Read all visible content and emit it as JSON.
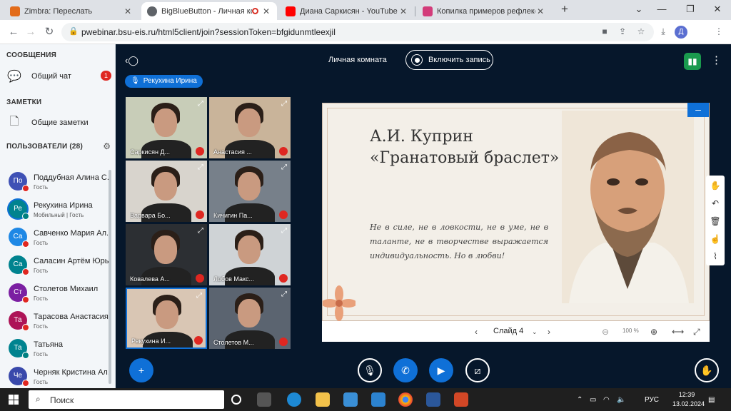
{
  "browser": {
    "tabs": [
      {
        "title": "Zimbra: Переслать",
        "color": "#e26b1a"
      },
      {
        "title": "BigBlueButton - Личная ко",
        "color": "#5f6368"
      },
      {
        "title": "Диана Саркисян - YouTube",
        "color": "#ff0000"
      },
      {
        "title": "Копилка примеров рефлексии",
        "color": "#d33c7a"
      }
    ],
    "new_tab": "+",
    "url": "pwebinar.bsu-eis.ru/html5client/join?sessionToken=bfgidunmtleexjil",
    "profile_initial": "Д"
  },
  "sidebar": {
    "messages_header": "СООБЩЕНИЯ",
    "public_chat": "Общий чат",
    "chat_badge": "1",
    "notes_header": "ЗАМЕТКИ",
    "shared_notes": "Общие заметки",
    "users_header": "ПОЛЬЗОВАТЕЛИ (28)",
    "users": [
      {
        "initials": "По",
        "name": "Поддубная Алина С...",
        "role": "Гость",
        "color": "#3f51b5",
        "mic": "muted"
      },
      {
        "initials": "Ре",
        "name": "Рекухина Ирина",
        "role": "Мобильный | Гость",
        "color": "#00838f",
        "mic": "on",
        "me": true
      },
      {
        "initials": "Са",
        "name": "Савченко Мария Ал...",
        "role": "Гость",
        "color": "#1e88e5",
        "mic": "muted"
      },
      {
        "initials": "Са",
        "name": "Саласин Артём Юрь...",
        "role": "Гость",
        "color": "#00838f",
        "mic": "muted"
      },
      {
        "initials": "Ст",
        "name": "Столетов Михаил",
        "role": "Гость",
        "color": "#7b1fa2",
        "mic": "muted"
      },
      {
        "initials": "Та",
        "name": "Тарасова Анастасия...",
        "role": "Гость",
        "color": "#ad1457",
        "mic": "muted"
      },
      {
        "initials": "Та",
        "name": "Татьяна",
        "role": "Гость",
        "color": "#00838f",
        "mic": "on"
      },
      {
        "initials": "Че",
        "name": "Черняк Кристина Ал...",
        "role": "Гость",
        "color": "#3949ab",
        "mic": "muted"
      }
    ]
  },
  "meeting": {
    "room_title": "Личная комната",
    "record_label": "Включить запись",
    "talking": "Рекухина Ирина",
    "videos": [
      {
        "name": "Саркисян Д...",
        "bg": "#c8cdb8"
      },
      {
        "name": "Анастасия ...",
        "bg": "#c9b49a"
      },
      {
        "name": "Варвара Бо...",
        "bg": "#d8d4cd"
      },
      {
        "name": "Кичигин Па...",
        "bg": "#77808a"
      },
      {
        "name": "Ковалева А...",
        "bg": "#2c2f33"
      },
      {
        "name": "Лобов Макс...",
        "bg": "#cfd3d6"
      },
      {
        "name": "Рекухина И...",
        "bg": "#d9c6b4",
        "active": true
      },
      {
        "name": "Столетов М...",
        "bg": "#5b6470"
      }
    ]
  },
  "presentation": {
    "title_line1": "А.И. Куприн",
    "title_line2": "«Гранатовый браслет»",
    "quote": "Не в силе, не в ловкости, не в уме, не в таланте, не в творчестве выражается индивидуальность. Но в любви!",
    "slide_label": "Слайд 4",
    "zoom": "100 %"
  },
  "taskbar": {
    "search_placeholder": "Поиск",
    "lang": "РУС",
    "time": "12:39",
    "date": "13.02.2024"
  }
}
